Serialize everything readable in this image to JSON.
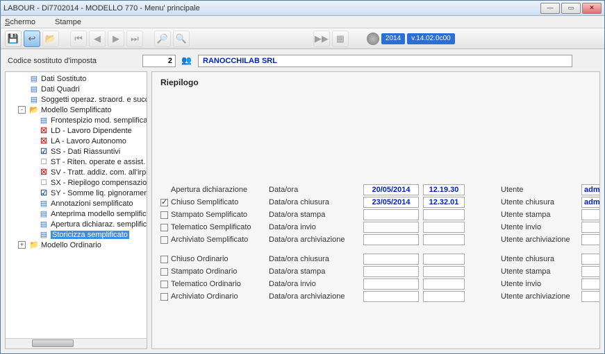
{
  "window": {
    "title": "LABOUR - Di7702014 - MODELLO 770 - Menu' principale"
  },
  "menu": {
    "schermo": "Schermo",
    "stampe": "Stampe"
  },
  "toolbar": {
    "year": "2014",
    "version": "v.14.02.0c00"
  },
  "header": {
    "label": "Codice sostituto d'imposta",
    "code": "2",
    "company": "RANOCCHILAB SRL"
  },
  "tree": {
    "items": [
      {
        "lvl": 1,
        "exp": "",
        "ic": "form",
        "icTxt": "▤",
        "label": "Dati Sostituto"
      },
      {
        "lvl": 1,
        "exp": "",
        "ic": "form",
        "icTxt": "▤",
        "label": "Dati Quadri"
      },
      {
        "lvl": 1,
        "exp": "",
        "ic": "form",
        "icTxt": "▤",
        "label": "Soggetti operaz. straord. e succes."
      },
      {
        "lvl": 1,
        "exp": "-",
        "ic": "folder",
        "icTxt": "📂",
        "label": "Modello Semplificato"
      },
      {
        "lvl": 2,
        "exp": "",
        "ic": "form",
        "icTxt": "▤",
        "label": "Frontespizio mod. semplificato"
      },
      {
        "lvl": 2,
        "exp": "",
        "ic": "redx",
        "icTxt": "☒",
        "label": "LD - Lavoro Dipendente"
      },
      {
        "lvl": 2,
        "exp": "",
        "ic": "redx",
        "icTxt": "☒",
        "label": "LA - Lavoro Autonomo"
      },
      {
        "lvl": 2,
        "exp": "",
        "ic": "chk",
        "icTxt": "☑",
        "label": "SS - Dati Riassuntivi"
      },
      {
        "lvl": 2,
        "exp": "",
        "ic": "box",
        "icTxt": "☐",
        "label": "ST - Riten. operate e assist. fisc."
      },
      {
        "lvl": 2,
        "exp": "",
        "ic": "redx",
        "icTxt": "☒",
        "label": "SV - Tratt. addiz. com. all'irpef"
      },
      {
        "lvl": 2,
        "exp": "",
        "ic": "box",
        "icTxt": "☐",
        "label": "SX - Riepilogo compensazioni"
      },
      {
        "lvl": 2,
        "exp": "",
        "ic": "chk",
        "icTxt": "☑",
        "label": "SY - Somme liq. pignoramento"
      },
      {
        "lvl": 2,
        "exp": "",
        "ic": "form",
        "icTxt": "▤",
        "label": "Annotazioni semplificato"
      },
      {
        "lvl": 2,
        "exp": "",
        "ic": "form",
        "icTxt": "▤",
        "label": "Anteprima modello semplificato"
      },
      {
        "lvl": 2,
        "exp": "",
        "ic": "form",
        "icTxt": "▤",
        "label": "Apertura dichiaraz. semplificato"
      },
      {
        "lvl": 2,
        "exp": "",
        "ic": "form",
        "icTxt": "▤",
        "label": "Storicizza semplificato",
        "sel": true
      },
      {
        "lvl": 1,
        "exp": "+",
        "ic": "folder",
        "icTxt": "📁",
        "label": "Modello Ordinario"
      }
    ]
  },
  "detail": {
    "title": "Riepilogo",
    "rows_a": [
      {
        "chk": false,
        "noBox": true,
        "label": "Apertura dichiarazione",
        "mid": "Data/ora",
        "date": "20/05/2014",
        "time": "12.19.30",
        "ulabel": "Utente",
        "uval": "admin",
        "bold": true
      },
      {
        "chk": true,
        "label": "Chiuso Semplificato",
        "mid": "Data/ora chiusura",
        "date": "23/05/2014",
        "time": "12.32.01",
        "ulabel": "Utente chiusura",
        "uval": "admin",
        "bold": true
      },
      {
        "chk": false,
        "label": "Stampato Semplificato",
        "mid": "Data/ora stampa",
        "date": "",
        "time": "",
        "ulabel": "Utente stampa",
        "uval": ""
      },
      {
        "chk": false,
        "label": "Telematico Semplificato",
        "mid": "Data/ora invio",
        "date": "",
        "time": "",
        "ulabel": "Utente invio",
        "uval": ""
      },
      {
        "chk": false,
        "label": "Archiviato Semplificato",
        "mid": "Data/ora archiviazione",
        "date": "",
        "time": "",
        "ulabel": "Utente archiviazione",
        "uval": ""
      }
    ],
    "rows_b": [
      {
        "chk": false,
        "label": "Chiuso Ordinario",
        "mid": "Data/ora chiusura",
        "date": "",
        "time": "",
        "ulabel": "Utente chiusura",
        "uval": ""
      },
      {
        "chk": false,
        "label": "Stampato Ordinario",
        "mid": "Data/ora stampa",
        "date": "",
        "time": "",
        "ulabel": "Utente stampa",
        "uval": ""
      },
      {
        "chk": false,
        "label": "Telematico Ordinario",
        "mid": "Data/ora invio",
        "date": "",
        "time": "",
        "ulabel": "Utente invio",
        "uval": ""
      },
      {
        "chk": false,
        "label": "Archiviato Ordinario",
        "mid": "Data/ora archiviazione",
        "date": "",
        "time": "",
        "ulabel": "Utente archiviazione",
        "uval": ""
      }
    ]
  }
}
